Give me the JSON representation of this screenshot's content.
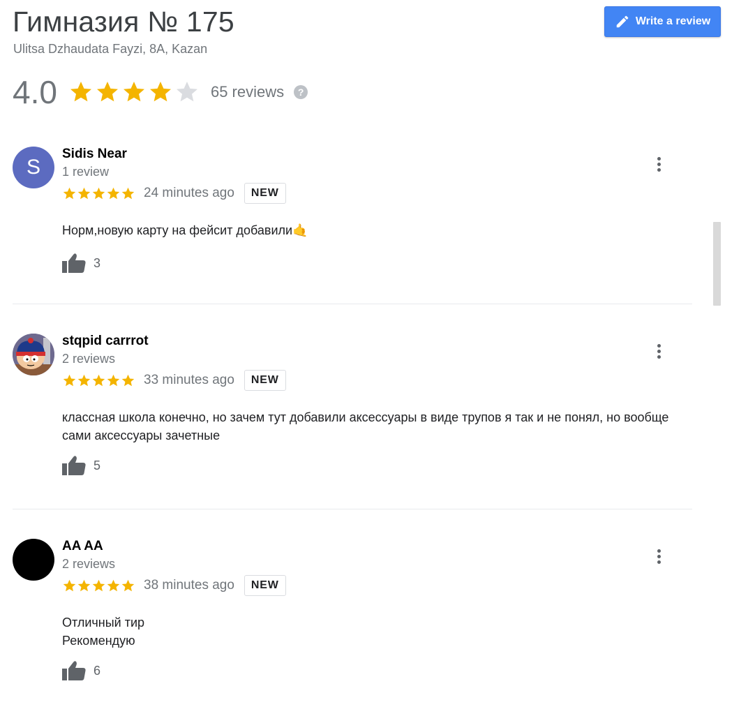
{
  "place": {
    "title": "Гимназия № 175",
    "address": "Ulitsa Dzhaudata Fayzi, 8A, Kazan"
  },
  "write_review": {
    "label": "Write a review",
    "icon": "pencil-icon"
  },
  "rating": {
    "value": "4.0",
    "stars": 4,
    "max_stars": 5,
    "review_count": "65 reviews",
    "help_icon": "help-icon"
  },
  "colors": {
    "star_filled": "#f4b400",
    "star_empty": "#dadce0",
    "button_blue": "#4285f4",
    "avatar_s": "#5c6bc0"
  },
  "reviews": [
    {
      "name": "Sidis Near",
      "meta": "1 review",
      "avatar": "S",
      "stars": 5,
      "time": "24 minutes ago",
      "badge": "NEW",
      "text": "Норм,новую карту на фейсит добавили🤙",
      "likes": "3"
    },
    {
      "name": "stqpid carrrot",
      "meta": "2 reviews",
      "avatar": "",
      "stars": 5,
      "time": "33 minutes ago",
      "badge": "NEW",
      "text": "классная школа конечно, но зачем тут добавили аксессуары в виде трупов я так и не понял, но вообще сами аксессуары зачетные",
      "likes": "5"
    },
    {
      "name": "AA AA",
      "meta": "2 reviews",
      "avatar": "",
      "stars": 5,
      "time": "38 minutes ago",
      "badge": "NEW",
      "text": "Отличный тир\nРекомендую",
      "likes": "6"
    }
  ]
}
